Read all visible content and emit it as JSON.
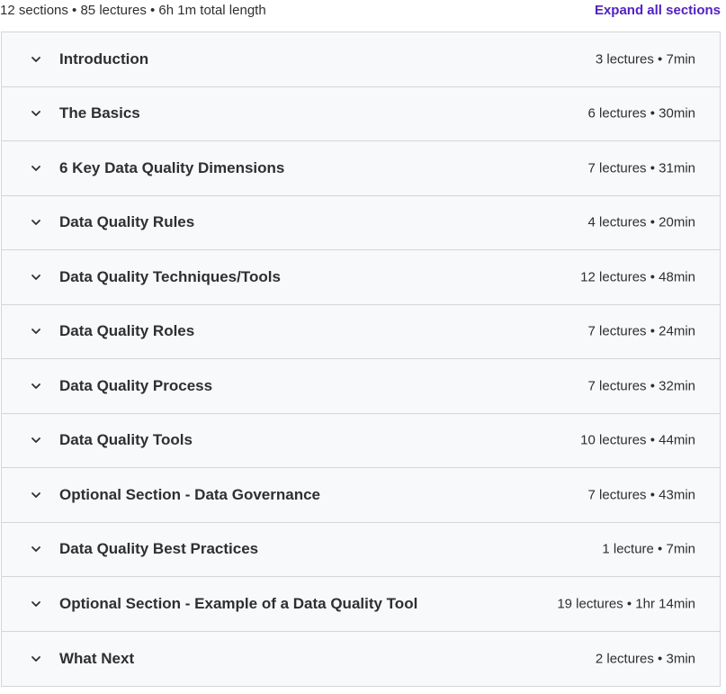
{
  "summary": "12 sections • 85 lectures • 6h 1m total length",
  "expand_all_label": "Expand all sections",
  "accent_color": "#5022c3",
  "chevron_icon": "chevron-down-icon",
  "sections": [
    {
      "title": "Introduction",
      "meta": "3 lectures • 7min"
    },
    {
      "title": "The Basics",
      "meta": "6 lectures • 30min"
    },
    {
      "title": "6 Key Data Quality Dimensions",
      "meta": "7 lectures • 31min"
    },
    {
      "title": "Data Quality Rules",
      "meta": "4 lectures • 20min"
    },
    {
      "title": "Data Quality Techniques/Tools",
      "meta": "12 lectures • 48min"
    },
    {
      "title": "Data Quality Roles",
      "meta": "7 lectures • 24min"
    },
    {
      "title": "Data Quality Process",
      "meta": "7 lectures • 32min"
    },
    {
      "title": "Data Quality Tools",
      "meta": "10 lectures • 44min"
    },
    {
      "title": "Optional Section - Data Governance",
      "meta": "7 lectures • 43min"
    },
    {
      "title": "Data Quality Best Practices",
      "meta": "1 lecture • 7min"
    },
    {
      "title": "Optional Section - Example of a Data Quality Tool",
      "meta": "19 lectures • 1hr 14min"
    },
    {
      "title": "What Next",
      "meta": "2 lectures • 3min"
    }
  ]
}
